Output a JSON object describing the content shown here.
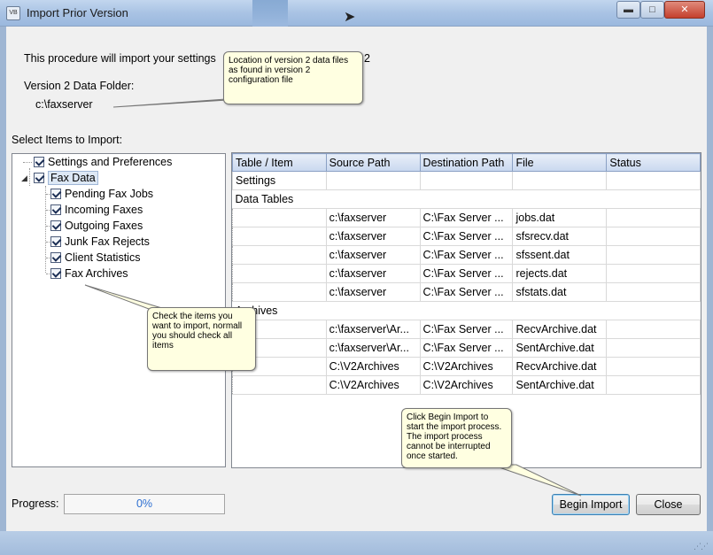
{
  "window": {
    "title": "Import Prior Version",
    "app_icon": "fax-app-icon",
    "icon_text": "VB",
    "controls": {
      "minimize": "▬",
      "maximize": "□",
      "close": "✕"
    }
  },
  "intro": {
    "text": "This procedure will import your settings",
    "text_tail": "2"
  },
  "folder": {
    "label": "Version 2 Data Folder:",
    "value": "c:\\faxserver"
  },
  "select_label": "Select Items to Import:",
  "callouts": {
    "folder": "Location of version 2 data files as found in version 2 configuration file",
    "tree": "Check the items you want to import, normall you should check all items",
    "begin": "Click Begin Import to start the import process.  The import process cannot be interrupted once started."
  },
  "tree": {
    "items": [
      {
        "label": "Settings and Preferences",
        "checked": true
      },
      {
        "label": "Fax Data",
        "checked": true,
        "expanded": true,
        "selected": true
      },
      {
        "label": "Pending Fax Jobs",
        "checked": true
      },
      {
        "label": "Incoming Faxes",
        "checked": true
      },
      {
        "label": "Outgoing Faxes",
        "checked": true
      },
      {
        "label": "Junk Fax Rejects",
        "checked": true
      },
      {
        "label": "Client Statistics",
        "checked": true
      },
      {
        "label": "Fax Archives",
        "checked": true
      }
    ]
  },
  "grid": {
    "columns": [
      "Table / Item",
      "Source Path",
      "Destination Path",
      "File",
      "Status"
    ],
    "groups": {
      "settings": "Settings",
      "data_tables": "Data Tables",
      "archives": "Archives"
    },
    "data_rows": [
      {
        "source": "c:\\faxserver",
        "dest": "C:\\Fax Server ...",
        "file": "jobs.dat",
        "status": ""
      },
      {
        "source": "c:\\faxserver",
        "dest": "C:\\Fax Server ...",
        "file": "sfsrecv.dat",
        "status": ""
      },
      {
        "source": "c:\\faxserver",
        "dest": "C:\\Fax Server ...",
        "file": "sfssent.dat",
        "status": ""
      },
      {
        "source": "c:\\faxserver",
        "dest": "C:\\Fax Server ...",
        "file": "rejects.dat",
        "status": ""
      },
      {
        "source": "c:\\faxserver",
        "dest": "C:\\Fax Server ...",
        "file": "sfstats.dat",
        "status": ""
      }
    ],
    "archive_rows": [
      {
        "source": "c:\\faxserver\\Ar...",
        "dest": "C:\\Fax Server ...",
        "file": "RecvArchive.dat",
        "status": ""
      },
      {
        "source": "c:\\faxserver\\Ar...",
        "dest": "C:\\Fax Server ...",
        "file": "SentArchive.dat",
        "status": ""
      },
      {
        "source": "C:\\V2Archives",
        "dest": "C:\\V2Archives",
        "file": "RecvArchive.dat",
        "status": ""
      },
      {
        "source": "C:\\V2Archives",
        "dest": "C:\\V2Archives",
        "file": "SentArchive.dat",
        "status": ""
      }
    ]
  },
  "progress": {
    "label": "Progress:",
    "value_text": "0%",
    "value": 0
  },
  "buttons": {
    "begin": "Begin Import",
    "close": "Close"
  }
}
